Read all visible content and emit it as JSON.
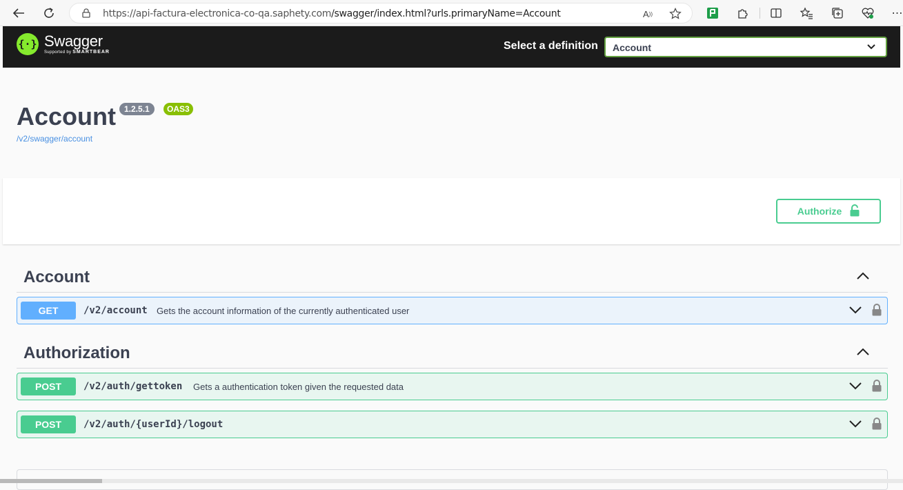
{
  "browser": {
    "url_host": "https://api-factura-electronica-co-qa.saphety.com",
    "url_path": "/swagger/index.html?urls.primaryName=Account",
    "icons": [
      "back-icon",
      "refresh-icon",
      "lock-icon",
      "read-aloud-icon",
      "favorite-star-icon",
      "extension-green-icon",
      "extensions-puzzle-icon",
      "split-screen-icon",
      "favorites-icon",
      "collections-icon",
      "health-icon",
      "more-icon"
    ]
  },
  "topbar": {
    "logo_name": "Swagger",
    "logo_sub_prefix": "Supported by",
    "logo_sub_brand": "SMARTBEAR",
    "select_label": "Select a definition",
    "select_value": "Account"
  },
  "info": {
    "title": "Account",
    "version": "1.2.5.1",
    "oas": "OAS3",
    "link": "/v2/swagger/account"
  },
  "scheme": {
    "authorize_label": "Authorize"
  },
  "tags": [
    {
      "name": "Account",
      "operations": [
        {
          "method": "GET",
          "path": "/v2/account",
          "summary": "Gets the account information of the currently authenticated user"
        }
      ]
    },
    {
      "name": "Authorization",
      "operations": [
        {
          "method": "POST",
          "path": "/v2/auth/gettoken",
          "summary": "Gets a authentication token given the requested data"
        },
        {
          "method": "POST",
          "path": "/v2/auth/{userId}/logout",
          "summary": ""
        }
      ]
    }
  ],
  "colors": {
    "get": "#61affe",
    "post": "#49cc90",
    "swagger_green": "#85ea2d",
    "topbar": "#1b1b1b"
  }
}
